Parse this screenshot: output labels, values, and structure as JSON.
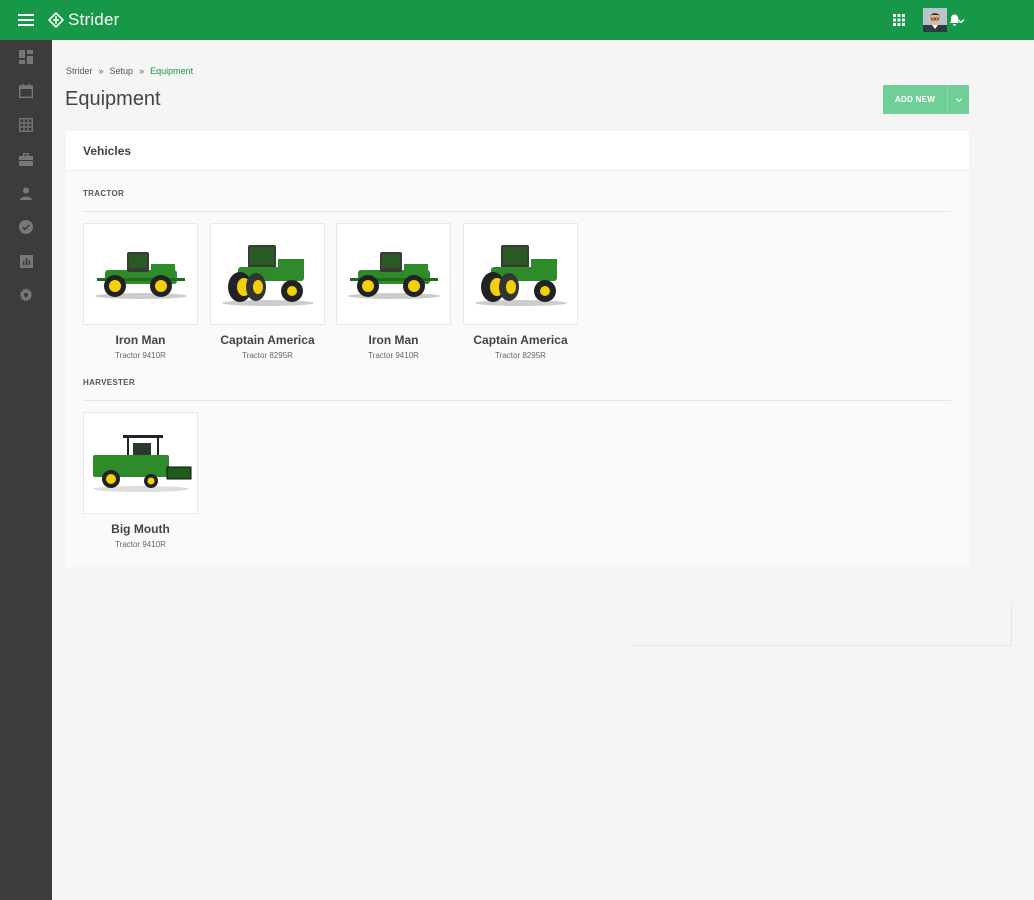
{
  "app": {
    "brand": "Strider"
  },
  "breadcrumb": [
    {
      "label": "Strider"
    },
    {
      "label": "Setup"
    },
    {
      "label": "Equipment"
    }
  ],
  "breadcrumb_separator": "»",
  "page": {
    "title": "Equipment"
  },
  "actions": {
    "add_new_label": "ADD NEW"
  },
  "card": {
    "title": "Vehicles",
    "sections": [
      {
        "label": "TRACTOR",
        "items": [
          {
            "name": "Iron Man",
            "model": "Tractor 9410R",
            "icon": "tractor-9410r-image"
          },
          {
            "name": "Captain America",
            "model": "Tractor 8295R",
            "icon": "tractor-8295r-image"
          },
          {
            "name": "Iron Man",
            "model": "Tractor 9410R",
            "icon": "tractor-9410r-image"
          },
          {
            "name": "Captain America",
            "model": "Tractor 8295R",
            "icon": "tractor-8295r-image"
          }
        ]
      },
      {
        "label": "HARVESTER",
        "items": [
          {
            "name": "Big Mouth",
            "model": "Tractor 9410R",
            "icon": "harvester-image"
          }
        ]
      }
    ]
  },
  "colors": {
    "brand_green": "#169848",
    "button_green": "#6fcf97",
    "sidebar": "#3c3c3c",
    "tractor_green": "#2f8a2a",
    "tractor_yellow": "#f2d00a"
  },
  "sidebar_icons": [
    "dashboard-icon",
    "calendar-icon",
    "grid-icon",
    "briefcase-icon",
    "person-icon",
    "check-circle-icon",
    "report-icon",
    "gear-icon"
  ]
}
